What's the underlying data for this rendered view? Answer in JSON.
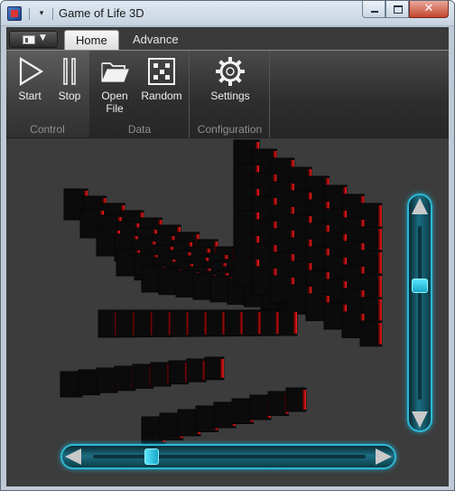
{
  "window": {
    "title": "Game of Life 3D"
  },
  "quick_access": {
    "dropdown_glyph": "▾"
  },
  "app_menu": {
    "caret": "▼"
  },
  "ribbon": {
    "tabs": [
      {
        "label": "Home",
        "active": true
      },
      {
        "label": "Advance",
        "active": false
      }
    ],
    "groups": [
      {
        "label": "Control",
        "buttons": [
          {
            "label": "Start",
            "icon": "play-icon"
          },
          {
            "label": "Stop",
            "icon": "pause-icon"
          }
        ]
      },
      {
        "label": "Data",
        "buttons": [
          {
            "label_line1": "Open",
            "label_line2": "File",
            "icon": "folder-open-icon"
          },
          {
            "label": "Random",
            "icon": "dice-icon"
          }
        ]
      },
      {
        "label": "Configuration",
        "buttons": [
          {
            "label": "Settings",
            "icon": "gear-icon"
          }
        ]
      }
    ]
  },
  "viewport": {
    "background": "#3c3c3c",
    "cube_color": "#0b0b0b",
    "cell_accent": "#d41010"
  },
  "scrollbars": {
    "accent": "#2fb8d4",
    "vertical_value": 0.33,
    "horizontal_value": 0.2
  },
  "close_glyph": "✕"
}
